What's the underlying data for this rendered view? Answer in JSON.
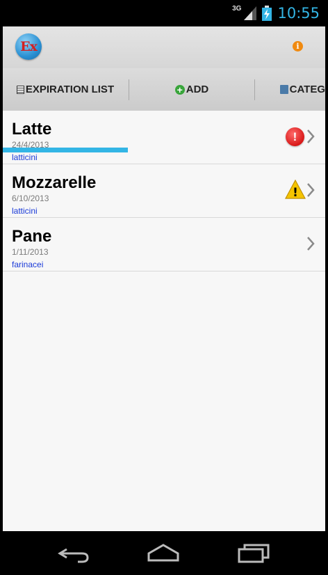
{
  "status_bar": {
    "network": "3G",
    "time": "10:55"
  },
  "app": {
    "logo_text": "Ex",
    "info_glyph": "i"
  },
  "tabs": [
    {
      "label": "EXPIRATION LIST",
      "icon": "list-icon",
      "selected": true
    },
    {
      "label": "ADD",
      "icon": "add-icon",
      "selected": false
    },
    {
      "label": "CATEG",
      "icon": "category-icon",
      "selected": false
    }
  ],
  "items": [
    {
      "name": "Latte",
      "date": "24/4/2013",
      "category": "latticini",
      "status": "expired",
      "status_icon": "error-icon",
      "status_glyph": "!"
    },
    {
      "name": "Mozzarelle",
      "date": "6/10/2013",
      "category": "latticini",
      "status": "warning",
      "status_icon": "warning-icon",
      "status_glyph": "!"
    },
    {
      "name": "Pane",
      "date": "1/11/2013",
      "category": "farinacei",
      "status": "ok"
    }
  ],
  "nav": {
    "back": "back-icon",
    "home": "home-icon",
    "recents": "recents-icon"
  },
  "colors": {
    "accent": "#33b5e5",
    "category_text": "#1a3ad8",
    "error": "#d81818",
    "warning": "#f5c400"
  }
}
